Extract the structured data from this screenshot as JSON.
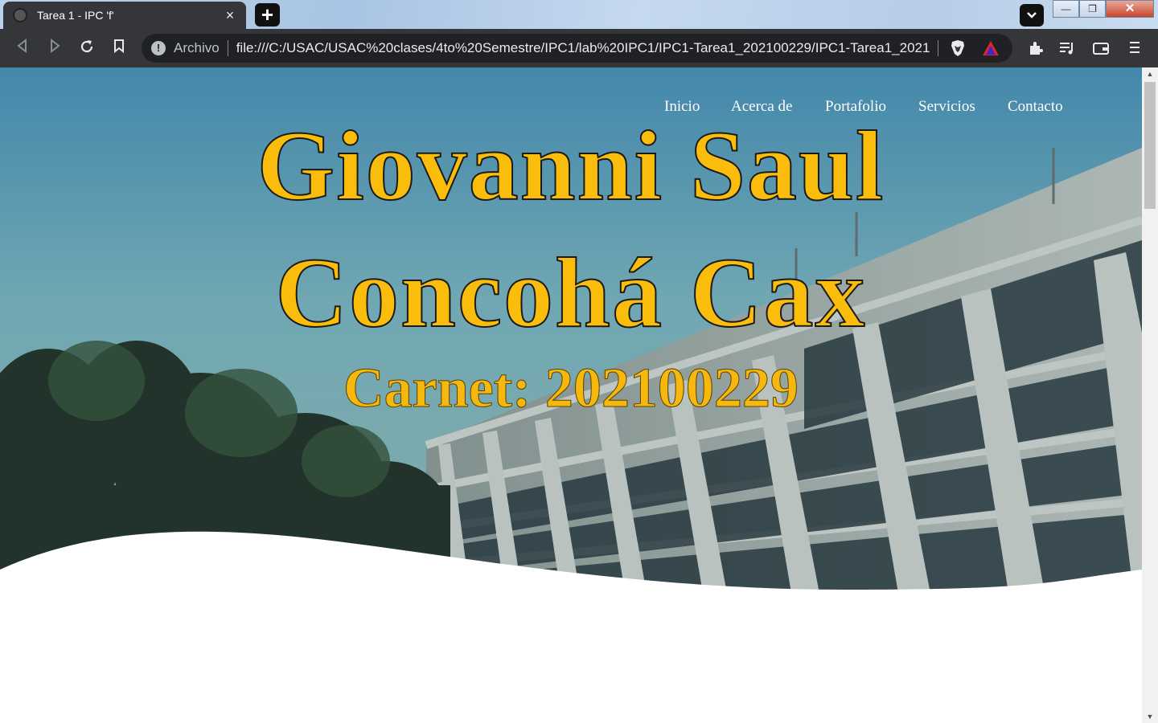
{
  "browser": {
    "tab_title": "Tarea 1 - IPC 'f'",
    "tab_close": "×",
    "new_tab": "+",
    "tab_search_icon": "chevron-down-icon",
    "omnibox": {
      "security_label": "Archivo",
      "url": "file:///C:/USAC/USAC%20clases/4to%20Semestre/IPC1/lab%20IPC1/IPC1-Tarea1_202100229/IPC1-Tarea1_2021..."
    },
    "window_buttons": {
      "minimize": "—",
      "restore": "❐",
      "close": "✕"
    }
  },
  "page": {
    "nav": [
      {
        "label": "Inicio"
      },
      {
        "label": "Acerca de"
      },
      {
        "label": "Portafolio"
      },
      {
        "label": "Servicios"
      },
      {
        "label": "Contacto"
      }
    ],
    "name_line1": "Giovanni Saul",
    "name_line2": "Concohá Cax",
    "carnet": "Carnet: 202100229",
    "title_color": "#fbbd0b"
  }
}
